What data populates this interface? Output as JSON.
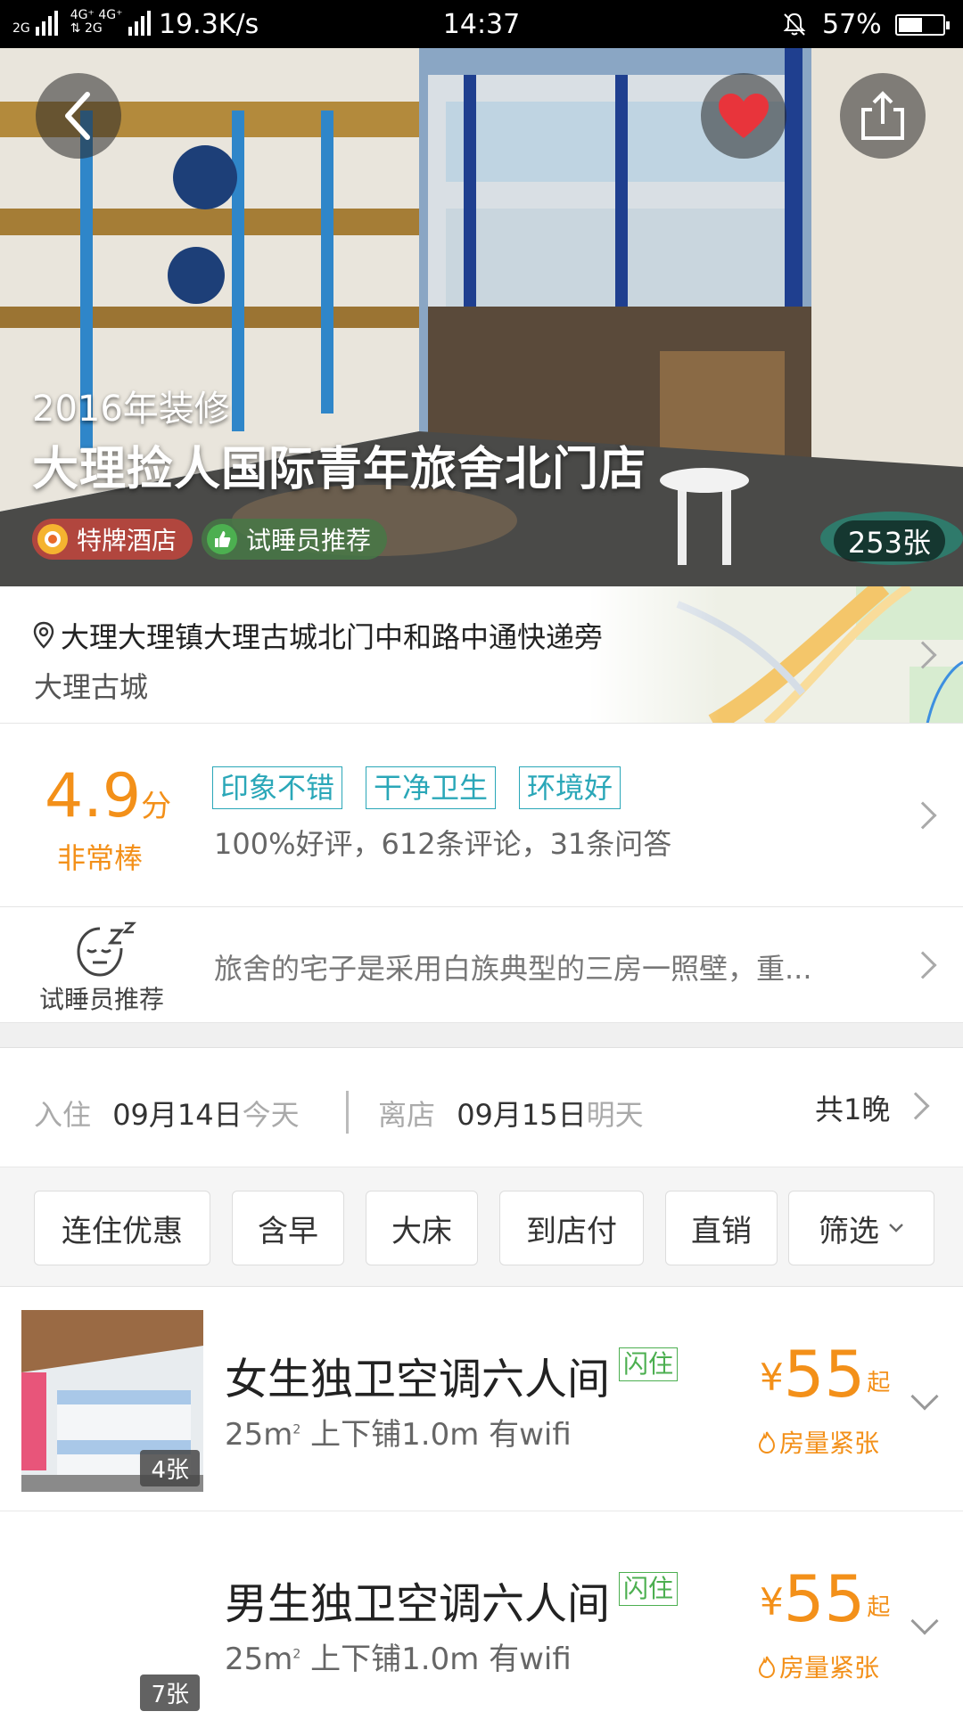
{
  "status_bar": {
    "net_left": "2G",
    "net_mid_top": "4G⁺ 4G⁺",
    "net_mid_bottom": "⇅ 2G",
    "speed": "19.3K/s",
    "time": "14:37",
    "battery": "57%"
  },
  "hero": {
    "renovation": "2016年装修",
    "title": "大理捡人国际青年旅舍北门店",
    "badges": [
      "特牌酒店",
      "试睡员推荐"
    ],
    "photo_count": "253张"
  },
  "address": {
    "line1": "大理大理镇大理古城北门中和路中通快递旁",
    "line2": "大理古城"
  },
  "rating": {
    "score": "4.9",
    "unit": "分",
    "label": "非常棒",
    "tags": [
      "印象不错",
      "干净卫生",
      "环境好"
    ],
    "stats": "100%好评，612条评论，31条问答"
  },
  "sleeper": {
    "label": "试睡员推荐",
    "text": "旅舍的宅子是采用白族典型的三房一照壁，重..."
  },
  "dates": {
    "checkin_label": "入住",
    "checkin_date": "09月14日",
    "checkin_rel": "今天",
    "checkout_label": "离店",
    "checkout_date": "09月15日",
    "checkout_rel": "明天",
    "nights": "共1晚"
  },
  "filters": [
    "连住优惠",
    "含早",
    "大床",
    "到店付",
    "直销",
    "筛选"
  ],
  "rooms": [
    {
      "name": "女生独卫空调六人间",
      "flash": "闪住",
      "area": "25m",
      "area_sup": "2",
      "info": "上下铺1.0m 有wifi",
      "currency": "¥",
      "price": "55",
      "price_suffix": "起",
      "scarce": "房量紧张",
      "img_count": "4张"
    },
    {
      "name": "男生独卫空调六人间",
      "flash": "闪住",
      "area": "25m",
      "area_sup": "2",
      "info": "上下铺1.0m 有wifi",
      "currency": "¥",
      "price": "55",
      "price_suffix": "起",
      "scarce": "房量紧张",
      "img_count": "7张"
    }
  ],
  "colors": {
    "accent_orange": "#f39019",
    "tag_teal": "#2aa7b8",
    "flash_green": "#4caf50",
    "favorite_red": "#e8343b"
  }
}
